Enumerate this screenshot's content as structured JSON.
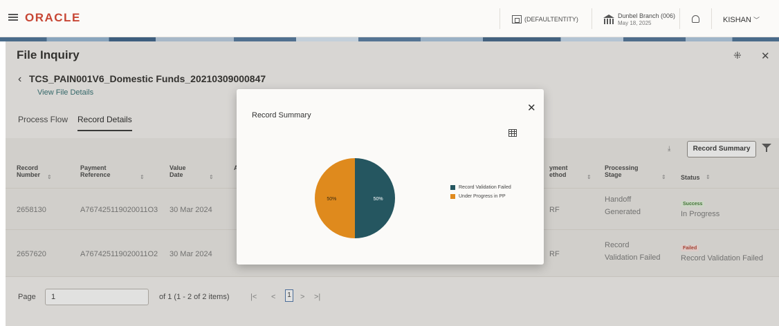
{
  "header": {
    "brand": "ORACLE",
    "entity": "(DEFAULTENTITY)",
    "branch": "Dunbel Branch (006)",
    "date": "May 18, 2025",
    "user": "KISHAN"
  },
  "page": {
    "title": "File Inquiry",
    "file_name": "TCS_PAIN001V6_Domestic Funds_20210309000847",
    "view_link": "View File Details",
    "tabs": [
      "Process Flow",
      "Record Details"
    ]
  },
  "table": {
    "columns_left": [
      {
        "l1": "Record",
        "l2": "Number"
      },
      {
        "l1": "Payment",
        "l2": "Reference"
      },
      {
        "l1": "Value",
        "l2": "Date"
      },
      {
        "l1": "A",
        "l2": ""
      }
    ],
    "columns_right": [
      {
        "l1": "yment",
        "l2": "ethod"
      },
      {
        "l1": "Processing",
        "l2": "Stage"
      },
      {
        "l1": "Status",
        "l2": ""
      }
    ],
    "rows": [
      {
        "record": "2658130",
        "reference": "A767425119020011O3",
        "value_date": "30 Mar 2024",
        "method": "RF",
        "stage_l1": "Handoff",
        "stage_l2": "Generated",
        "badge": "Success",
        "status": "In Progress"
      },
      {
        "record": "2657620",
        "reference": "A767425119020011O2",
        "value_date": "30 Mar 2024",
        "method": "RF",
        "stage_l1": "Record",
        "stage_l2": "Validation Failed",
        "badge": "Failed",
        "status": "Record Validation Failed"
      }
    ],
    "record_summary_button": "Record Summary"
  },
  "pagination": {
    "label": "Page",
    "current": "1",
    "of_text": "of 1  (1 - 2 of 2 items)",
    "first": "|<",
    "prev": "<",
    "page_btn": "1",
    "next": ">",
    "last": ">|"
  },
  "modal": {
    "title": "Record Summary",
    "close": "✕",
    "icons": [
      "grid-icon",
      "close-icon"
    ]
  },
  "chart_data": {
    "type": "pie",
    "values": [
      50,
      50
    ],
    "labels": [
      "Record Validation Failed",
      "Under Progress in PP"
    ],
    "data_labels": [
      "50%",
      "50%"
    ],
    "colors": [
      "#255660",
      "#df8a1d"
    ],
    "legend_position": "right"
  }
}
